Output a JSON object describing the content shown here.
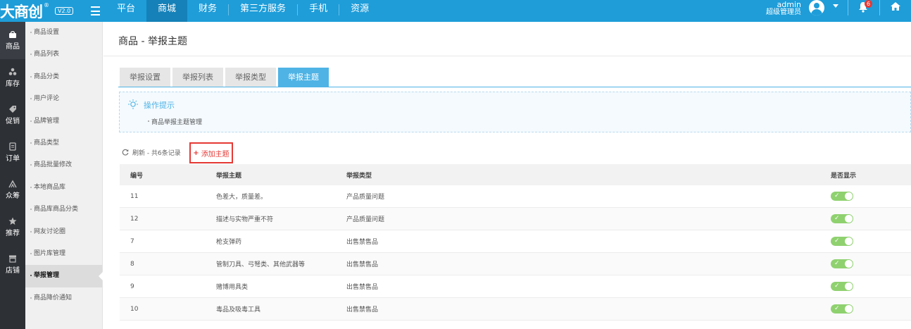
{
  "header": {
    "logo_text": "大商创",
    "logo_mark": "®",
    "version": "V2.0",
    "nav": [
      "平台",
      "商城",
      "财务",
      "第三方服务",
      "手机",
      "资源"
    ],
    "active_nav": "商城",
    "user_name": "admin",
    "user_role": "超级管理员",
    "notification_count": "6"
  },
  "leftbar": [
    {
      "label": "商品",
      "icon": "bag-icon"
    },
    {
      "label": "库存",
      "icon": "stock-icon"
    },
    {
      "label": "促销",
      "icon": "tag-icon"
    },
    {
      "label": "订单",
      "icon": "order-icon"
    },
    {
      "label": "众筹",
      "icon": "crowdfund-icon"
    },
    {
      "label": "推荐",
      "icon": "star-icon"
    },
    {
      "label": "店铺",
      "icon": "shop-icon"
    }
  ],
  "submenu": [
    "商品设置",
    "商品列表",
    "商品分类",
    "用户评论",
    "品牌管理",
    "商品类型",
    "商品批量修改",
    "本地商品库",
    "商品库商品分类",
    "网友讨论圈",
    "图片库管理",
    "举报管理",
    "商品降价通知"
  ],
  "page": {
    "title": "商品 - 举报主题",
    "tabs": [
      "举报设置",
      "举报列表",
      "举报类型",
      "举报主题"
    ],
    "active_tab": "举报主题",
    "tip_title": "操作提示",
    "tip_item": "商品举报主题管理",
    "toolbar_text": "刷新 - 共6条记录",
    "add_button": "添加主题"
  },
  "table": {
    "headers": [
      "编号",
      "举报主题",
      "举报类型",
      "是否显示"
    ],
    "rows": [
      {
        "id": "11",
        "theme": "色差大，质量差。",
        "type": "产品质量问题",
        "shown": true
      },
      {
        "id": "12",
        "theme": "描述与实物严重不符",
        "type": "产品质量问题",
        "shown": true
      },
      {
        "id": "7",
        "theme": "枪支弹药",
        "type": "出售禁售品",
        "shown": true
      },
      {
        "id": "8",
        "theme": "管制刀具、弓弩类、其他武器等",
        "type": "出售禁售品",
        "shown": true
      },
      {
        "id": "9",
        "theme": "赌博用具类",
        "type": "出售禁售品",
        "shown": true
      },
      {
        "id": "10",
        "theme": "毒品及吸毒工具",
        "type": "出售禁售品",
        "shown": true
      }
    ]
  },
  "colors": {
    "primary": "#1e9dd9",
    "tab_active": "#4fb3e5",
    "toggle_on": "#8fd16f",
    "highlight": "#e53935"
  }
}
